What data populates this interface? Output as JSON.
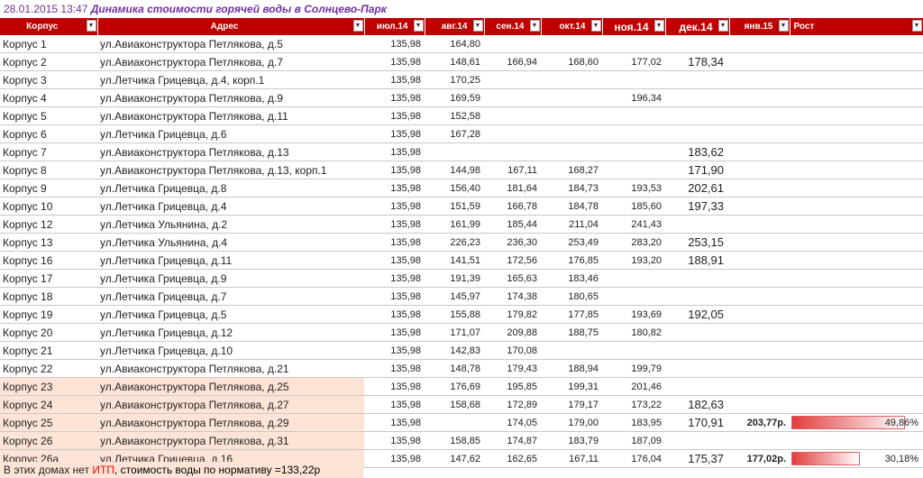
{
  "title": {
    "date": "28.01.2015 13:47",
    "text": "Динамика стоимости горячей воды в Солнцево-Парк"
  },
  "colors": {
    "header_bg": "#c00000",
    "highlight_bg": "#fde4d6",
    "title_text": "#7030a0",
    "bar_fill": "#e23c3c",
    "itp_text": "#ff0000"
  },
  "columns": {
    "korpus": "Корпус",
    "address": "Адрес",
    "jul": "июл.14",
    "aug": "авг.14",
    "sep": "сен.14",
    "oct": "окт.14",
    "nov": "ноя.14",
    "dec": "дек.14",
    "jan": "янв.15",
    "rost": "Рост",
    "dropdown_icon": "filter-dropdown-icon"
  },
  "rows": [
    {
      "korpus": "Корпус 1",
      "address": "ул.Авиаконструктора Петлякова, д.5",
      "jul": "135,98",
      "aug": "164,80",
      "sep": "",
      "oct": "",
      "nov": "",
      "dec": "",
      "jan": "",
      "rost": "",
      "hl": false
    },
    {
      "korpus": "Корпус 2",
      "address": "ул.Авиаконструктора Петлякова, д.7",
      "jul": "135,98",
      "aug": "148,61",
      "sep": "166,94",
      "oct": "168,60",
      "nov": "177,02",
      "dec": "178,34",
      "jan": "",
      "rost": "",
      "hl": false
    },
    {
      "korpus": "Корпус 3",
      "address": "ул.Летчика Грицевца, д.4, корп.1",
      "jul": "135,98",
      "aug": "170,25",
      "sep": "",
      "oct": "",
      "nov": "",
      "dec": "",
      "jan": "",
      "rost": "",
      "hl": false
    },
    {
      "korpus": "Корпус 4",
      "address": "ул.Авиаконструктора Петлякова, д.9",
      "jul": "135,98",
      "aug": "169,59",
      "sep": "",
      "oct": "",
      "nov": "196,34",
      "dec": "",
      "jan": "",
      "rost": "",
      "hl": false
    },
    {
      "korpus": "Корпус 5",
      "address": "ул.Авиаконструктора Петлякова, д.11",
      "jul": "135,98",
      "aug": "152,58",
      "sep": "",
      "oct": "",
      "nov": "",
      "dec": "",
      "jan": "",
      "rost": "",
      "hl": false
    },
    {
      "korpus": "Корпус 6",
      "address": "ул.Летчика Грицевца, д.6",
      "jul": "135,98",
      "aug": "167,28",
      "sep": "",
      "oct": "",
      "nov": "",
      "dec": "",
      "jan": "",
      "rost": "",
      "hl": false
    },
    {
      "korpus": "Корпус 7",
      "address": "ул.Авиаконструктора Петлякова, д.13",
      "jul": "135,98",
      "aug": "",
      "sep": "",
      "oct": "",
      "nov": "",
      "dec": "183,62",
      "jan": "",
      "rost": "",
      "hl": false
    },
    {
      "korpus": "Корпус 8",
      "address": "ул.Авиаконструктора Петлякова, д.13, корп.1",
      "jul": "135,98",
      "aug": "144,98",
      "sep": "167,11",
      "oct": "168,27",
      "nov": "",
      "dec": "171,90",
      "jan": "",
      "rost": "",
      "hl": false
    },
    {
      "korpus": "Корпус 9",
      "address": "ул.Летчика Грицевца, д.8",
      "jul": "135,98",
      "aug": "156,40",
      "sep": "181,64",
      "oct": "184,73",
      "nov": "193,53",
      "dec": "202,61",
      "jan": "",
      "rost": "",
      "hl": false
    },
    {
      "korpus": "Корпус 10",
      "address": "ул.Летчика Грицевца, д.4",
      "jul": "135,98",
      "aug": "151,59",
      "sep": "166,78",
      "oct": "184,78",
      "nov": "185,60",
      "dec": "197,33",
      "jan": "",
      "rost": "",
      "hl": false
    },
    {
      "korpus": "Корпус 12",
      "address": "ул.Летчика Ульянина, д.2",
      "jul": "135,98",
      "aug": "161,99",
      "sep": "185,44",
      "oct": "211,04",
      "nov": "241,43",
      "dec": "",
      "jan": "",
      "rost": "",
      "hl": false
    },
    {
      "korpus": "Корпус 13",
      "address": "ул.Летчика Ульянина, д.4",
      "jul": "135,98",
      "aug": "226,23",
      "sep": "236,30",
      "oct": "253,49",
      "nov": "283,20",
      "dec": "253,15",
      "jan": "",
      "rost": "",
      "hl": false
    },
    {
      "korpus": "Корпус 16",
      "address": "ул.Летчика Грицевца, д.11",
      "jul": "135,98",
      "aug": "141,51",
      "sep": "172,56",
      "oct": "176,85",
      "nov": "193,20",
      "dec": "188,91",
      "jan": "",
      "rost": "",
      "hl": false
    },
    {
      "korpus": "Корпус 17",
      "address": "ул.Летчика Грицевца, д.9",
      "jul": "135,98",
      "aug": "191,39",
      "sep": "165,63",
      "oct": "183,46",
      "nov": "",
      "dec": "",
      "jan": "",
      "rost": "",
      "hl": false
    },
    {
      "korpus": "Корпус 18",
      "address": "ул.Летчика Грицевца, д.7",
      "jul": "135,98",
      "aug": "145,97",
      "sep": "174,38",
      "oct": "180,65",
      "nov": "",
      "dec": "",
      "jan": "",
      "rost": "",
      "hl": false
    },
    {
      "korpus": "Корпус 19",
      "address": "ул.Летчика Грицевца, д.5",
      "jul": "135,98",
      "aug": "155,88",
      "sep": "179,82",
      "oct": "177,85",
      "nov": "193,69",
      "dec": "192,05",
      "jan": "",
      "rost": "",
      "hl": false
    },
    {
      "korpus": "Корпус 20",
      "address": "ул.Летчика Грицевца, д.12",
      "jul": "135,98",
      "aug": "171,07",
      "sep": "209,88",
      "oct": "188,75",
      "nov": "180,82",
      "dec": "",
      "jan": "",
      "rost": "",
      "hl": false
    },
    {
      "korpus": "Корпус 21",
      "address": "ул.Летчика Грицевца, д.10",
      "jul": "135,98",
      "aug": "142,83",
      "sep": "170,08",
      "oct": "",
      "nov": "",
      "dec": "",
      "jan": "",
      "rost": "",
      "hl": false
    },
    {
      "korpus": "Корпус 22",
      "address": "ул.Авиаконструктора Петлякова, д.21",
      "jul": "135,98",
      "aug": "148,78",
      "sep": "179,43",
      "oct": "188,94",
      "nov": "199,79",
      "dec": "",
      "jan": "",
      "rost": "",
      "hl": false
    },
    {
      "korpus": "Корпус 23",
      "address": "ул.Авиаконструктора Петлякова, д.25",
      "jul": "135,98",
      "aug": "176,69",
      "sep": "195,85",
      "oct": "199,31",
      "nov": "201,46",
      "dec": "",
      "jan": "",
      "rost": "",
      "hl": true
    },
    {
      "korpus": "Корпус 24",
      "address": "ул.Авиаконструктора Петлякова, д.27",
      "jul": "135,98",
      "aug": "158,68",
      "sep": "172,89",
      "oct": "179,17",
      "nov": "173,22",
      "dec": "182,63",
      "jan": "",
      "rost": "",
      "hl": true
    },
    {
      "korpus": "Корпус 25",
      "address": "ул.Авиаконструктора Петлякова, д.29",
      "jul": "135,98",
      "aug": "",
      "sep": "174,05",
      "oct": "179,00",
      "nov": "183,95",
      "dec": "170,91",
      "jan": "203,77р.",
      "rost": "49,86%",
      "rost_value": 0.4986,
      "hl": true
    },
    {
      "korpus": "Корпус 26",
      "address": "ул.Авиаконструктора Петлякова, д.31",
      "jul": "135,98",
      "aug": "158,85",
      "sep": "174,87",
      "oct": "183,79",
      "nov": "187,09",
      "dec": "",
      "jan": "",
      "rost": "",
      "hl": true
    },
    {
      "korpus": "Корпус 26а",
      "address": "ул.Летчика Грицевца, д.16",
      "jul": "135,98",
      "aug": "147,62",
      "sep": "162,65",
      "oct": "167,11",
      "nov": "176,04",
      "dec": "175,37",
      "jan": "177,02р.",
      "rost": "30,18%",
      "rost_value": 0.3018,
      "hl": true
    }
  ],
  "footer": {
    "text_before": "В этих домах нет ",
    "itp": "ИТП",
    "text_after": ", стоимость воды по нормативу =133,22р"
  }
}
